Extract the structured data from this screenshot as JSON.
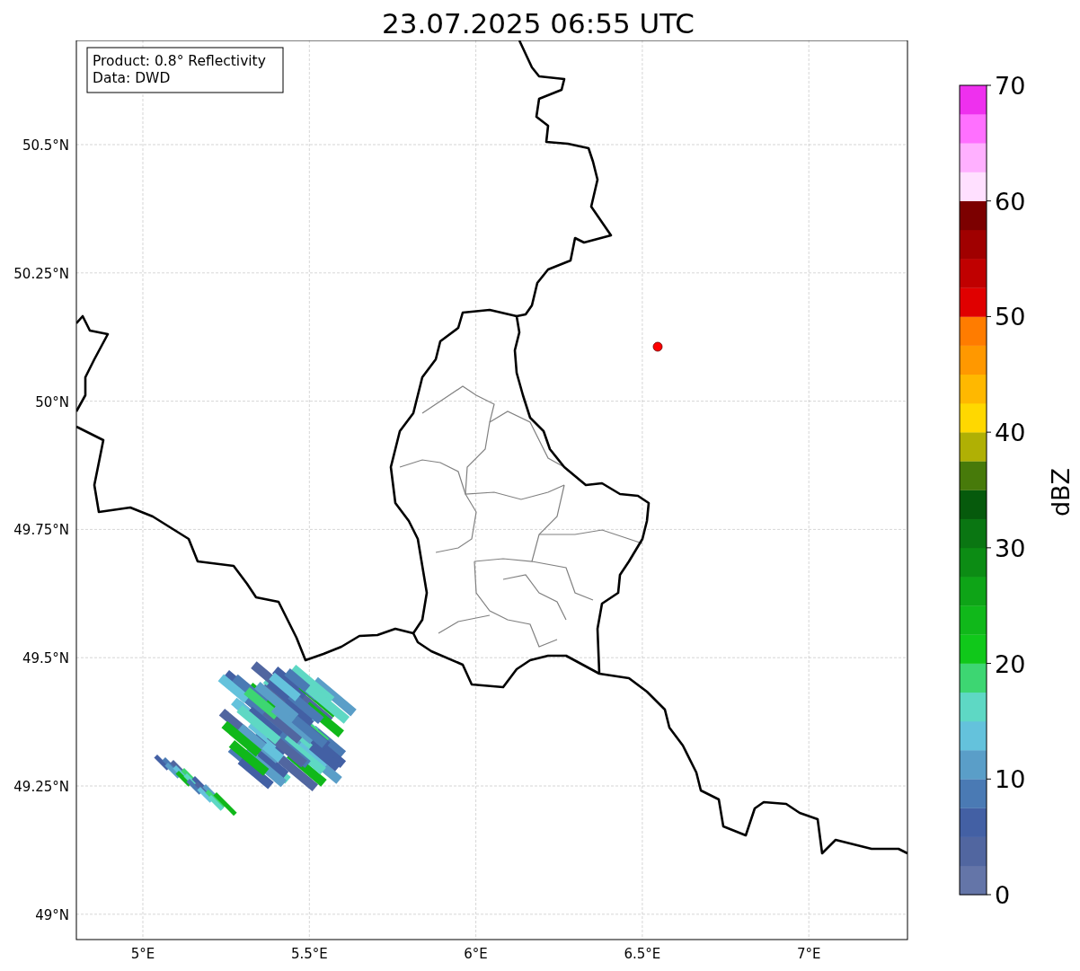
{
  "title": "23.07.2025 06:55 UTC",
  "map": {
    "info_box": [
      "Product: 0.8° Reflectivity",
      "Data: DWD"
    ],
    "lat_ticks": [
      "50.5°N",
      "50.25°N",
      "50°N",
      "49.75°N",
      "49.5°N",
      "49.25°N",
      "49°N"
    ],
    "lon_ticks": [
      "5°E",
      "5.5°E",
      "6°E",
      "6.5°E",
      "7°E"
    ]
  },
  "colorbar": {
    "label": "dBZ",
    "ticks": [
      "70",
      "60",
      "50",
      "40",
      "30",
      "20",
      "10",
      "0"
    ],
    "segments": [
      {
        "color": "#6475a8"
      },
      {
        "color": "#5166a0"
      },
      {
        "color": "#4360a4"
      },
      {
        "color": "#4a7ab4"
      },
      {
        "color": "#5a9ec8"
      },
      {
        "color": "#64c2dc"
      },
      {
        "color": "#5ed8c4"
      },
      {
        "color": "#3dd672"
      },
      {
        "color": "#10c81a"
      },
      {
        "color": "#10b81a"
      },
      {
        "color": "#0ea417"
      },
      {
        "color": "#0c8c14"
      },
      {
        "color": "#0a7612"
      },
      {
        "color": "#065a0c"
      },
      {
        "color": "#477a0a"
      },
      {
        "color": "#b0b004"
      },
      {
        "color": "#ffd800"
      },
      {
        "color": "#ffb800"
      },
      {
        "color": "#ff9800"
      },
      {
        "color": "#ff7c00"
      },
      {
        "color": "#e00000"
      },
      {
        "color": "#c00000"
      },
      {
        "color": "#a00000"
      },
      {
        "color": "#7c0000"
      },
      {
        "color": "#ffe0ff"
      },
      {
        "color": "#ffb0ff"
      },
      {
        "color": "#ff70ff"
      },
      {
        "color": "#ee30ee"
      }
    ]
  }
}
